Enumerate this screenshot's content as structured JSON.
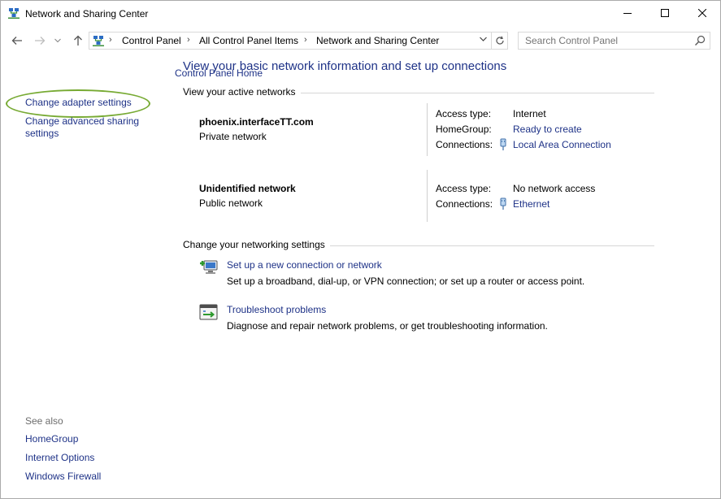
{
  "window": {
    "title": "Network and Sharing Center"
  },
  "address": {
    "segments": [
      "Control Panel",
      "All Control Panel Items",
      "Network and Sharing Center"
    ],
    "search_placeholder": "Search Control Panel"
  },
  "sidebar": {
    "home": "Control Panel Home",
    "items": [
      "Change adapter settings",
      "Change advanced sharing",
      "settings"
    ],
    "see_also_label": "See also",
    "see_also": [
      "HomeGroup",
      "Internet Options",
      "Windows Firewall"
    ]
  },
  "main": {
    "heading": "View your basic network information and set up connections",
    "active_label": "View your active networks",
    "networks": [
      {
        "name": "phoenix.interfaceTT.com",
        "type": "Private network",
        "access_key": "Access type:",
        "access_val": "Internet",
        "homegroup_key": "HomeGroup:",
        "homegroup_val": "Ready to create",
        "conn_key": "Connections:",
        "conn_val": "Local Area Connection"
      },
      {
        "name": "Unidentified network",
        "type": "Public network",
        "access_key": "Access type:",
        "access_val": "No network access",
        "conn_key": "Connections:",
        "conn_val": "Ethernet"
      }
    ],
    "change_label": "Change your networking settings",
    "tasks": [
      {
        "link": "Set up a new connection or network",
        "desc": "Set up a broadband, dial-up, or VPN connection; or set up a router or access point.",
        "icon": "new-connection-icon"
      },
      {
        "link": "Troubleshoot problems",
        "desc": "Diagnose and repair network problems, or get troubleshooting information.",
        "icon": "troubleshoot-icon"
      }
    ]
  },
  "colors": {
    "link": "#1e3287",
    "heading": "#1e3287",
    "highlight": "#77aa33",
    "divider": "#d6d6d6"
  }
}
